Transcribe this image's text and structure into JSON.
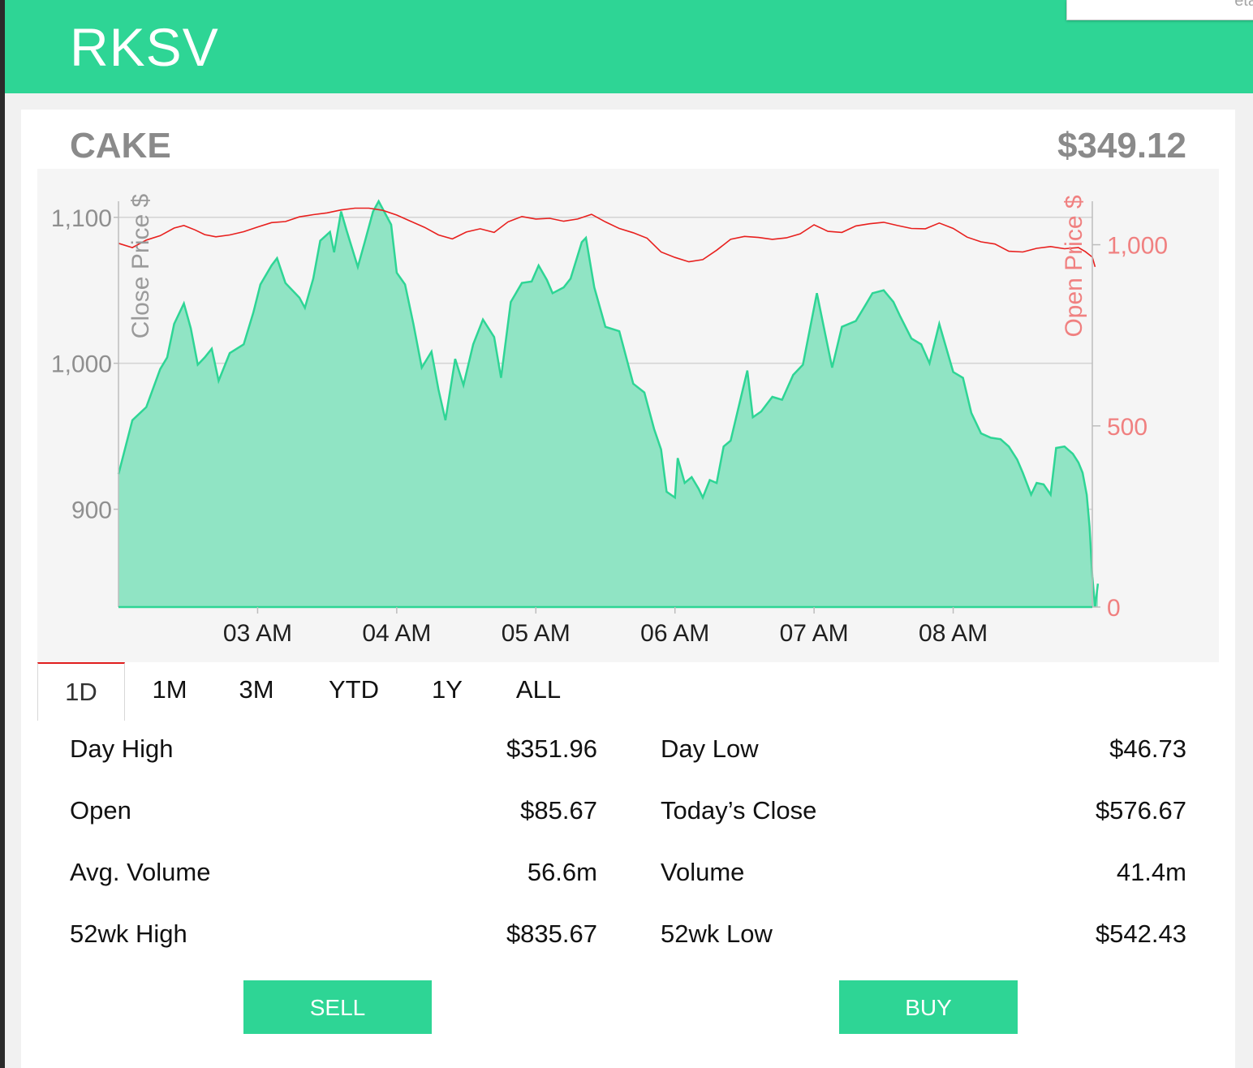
{
  "app": {
    "title": "RKSV"
  },
  "popup": {
    "partial_text": "eta"
  },
  "stock": {
    "symbol": "CAKE",
    "price": "$349.12"
  },
  "chart_data": {
    "type": "area",
    "title": "",
    "xlabel": "",
    "ylabel_left": "Close Price $",
    "ylabel_right": "Open Price $",
    "x_ticks": [
      "03 AM",
      "04 AM",
      "05 AM",
      "06 AM",
      "07 AM",
      "08 AM"
    ],
    "y_left_ticks": [
      900,
      1000,
      1100
    ],
    "y_left_tick_labels": [
      "900",
      "1,000",
      "1,100"
    ],
    "y_left_range": [
      833,
      1111
    ],
    "y_right_ticks": [
      0,
      500,
      1000
    ],
    "y_right_tick_labels": [
      "0",
      "500",
      "1,000"
    ],
    "y_right_range": [
      0,
      1120
    ],
    "x_range_hours": [
      2.0,
      9.0
    ],
    "grid": true,
    "colors": {
      "close": "#2ed595",
      "close_fill": "#90e4c4",
      "open": "#e8201e"
    },
    "series": [
      {
        "name": "Close Price $",
        "axis": "left",
        "points": [
          [
            2.0,
            924
          ],
          [
            2.1,
            961
          ],
          [
            2.2,
            970
          ],
          [
            2.3,
            996
          ],
          [
            2.35,
            1004
          ],
          [
            2.4,
            1027
          ],
          [
            2.47,
            1041
          ],
          [
            2.52,
            1024
          ],
          [
            2.57,
            999
          ],
          [
            2.62,
            1004
          ],
          [
            2.67,
            1010
          ],
          [
            2.72,
            988
          ],
          [
            2.8,
            1007
          ],
          [
            2.9,
            1013
          ],
          [
            2.97,
            1035
          ],
          [
            3.02,
            1054
          ],
          [
            3.1,
            1067
          ],
          [
            3.14,
            1072
          ],
          [
            3.2,
            1055
          ],
          [
            3.3,
            1045
          ],
          [
            3.34,
            1038
          ],
          [
            3.4,
            1058
          ],
          [
            3.45,
            1084
          ],
          [
            3.52,
            1090
          ],
          [
            3.55,
            1076
          ],
          [
            3.6,
            1104
          ],
          [
            3.64,
            1091
          ],
          [
            3.72,
            1066
          ],
          [
            3.77,
            1083
          ],
          [
            3.83,
            1104
          ],
          [
            3.87,
            1111
          ],
          [
            3.96,
            1095
          ],
          [
            4.0,
            1062
          ],
          [
            4.06,
            1054
          ],
          [
            4.12,
            1027
          ],
          [
            4.18,
            997
          ],
          [
            4.25,
            1008
          ],
          [
            4.3,
            982
          ],
          [
            4.35,
            961
          ],
          [
            4.42,
            1003
          ],
          [
            4.48,
            985
          ],
          [
            4.55,
            1013
          ],
          [
            4.62,
            1030
          ],
          [
            4.7,
            1018
          ],
          [
            4.75,
            990
          ],
          [
            4.82,
            1042
          ],
          [
            4.9,
            1055
          ],
          [
            4.97,
            1056
          ],
          [
            5.02,
            1067
          ],
          [
            5.08,
            1057
          ],
          [
            5.12,
            1048
          ],
          [
            5.2,
            1052
          ],
          [
            5.25,
            1058
          ],
          [
            5.33,
            1083
          ],
          [
            5.36,
            1086
          ],
          [
            5.42,
            1052
          ],
          [
            5.5,
            1025
          ],
          [
            5.6,
            1022
          ],
          [
            5.7,
            986
          ],
          [
            5.78,
            980
          ],
          [
            5.85,
            955
          ],
          [
            5.9,
            941
          ],
          [
            5.94,
            912
          ],
          [
            6.0,
            908
          ],
          [
            6.02,
            935
          ],
          [
            6.07,
            918
          ],
          [
            6.12,
            922
          ],
          [
            6.17,
            914
          ],
          [
            6.2,
            908
          ],
          [
            6.25,
            920
          ],
          [
            6.3,
            918
          ],
          [
            6.35,
            943
          ],
          [
            6.4,
            947
          ],
          [
            6.47,
            975
          ],
          [
            6.52,
            995
          ],
          [
            6.56,
            963
          ],
          [
            6.62,
            967
          ],
          [
            6.7,
            977
          ],
          [
            6.77,
            975
          ],
          [
            6.85,
            992
          ],
          [
            6.92,
            999
          ],
          [
            7.02,
            1048
          ],
          [
            7.08,
            1020
          ],
          [
            7.13,
            997
          ],
          [
            7.2,
            1025
          ],
          [
            7.3,
            1029
          ],
          [
            7.37,
            1040
          ],
          [
            7.42,
            1048
          ],
          [
            7.5,
            1050
          ],
          [
            7.57,
            1042
          ],
          [
            7.62,
            1032
          ],
          [
            7.7,
            1017
          ],
          [
            7.77,
            1013
          ],
          [
            7.83,
            1000
          ],
          [
            7.9,
            1027
          ],
          [
            8.0,
            994
          ],
          [
            8.07,
            990
          ],
          [
            8.13,
            966
          ],
          [
            8.2,
            952
          ],
          [
            8.27,
            949
          ],
          [
            8.34,
            948
          ],
          [
            8.4,
            943
          ],
          [
            8.46,
            934
          ],
          [
            8.5,
            925
          ],
          [
            8.56,
            910
          ],
          [
            8.6,
            918
          ],
          [
            8.65,
            917
          ],
          [
            8.7,
            910
          ],
          [
            8.74,
            942
          ],
          [
            8.8,
            943
          ],
          [
            8.86,
            938
          ],
          [
            8.9,
            932
          ],
          [
            8.93,
            925
          ],
          [
            8.96,
            910
          ],
          [
            8.98,
            888
          ],
          [
            9.0,
            854
          ],
          [
            9.02,
            833
          ],
          [
            9.04,
            849
          ]
        ]
      },
      {
        "name": "Open Price $",
        "axis": "right",
        "points": [
          [
            2.0,
            1004
          ],
          [
            2.1,
            992
          ],
          [
            2.2,
            1013
          ],
          [
            2.3,
            1025
          ],
          [
            2.4,
            1046
          ],
          [
            2.47,
            1053
          ],
          [
            2.55,
            1041
          ],
          [
            2.62,
            1028
          ],
          [
            2.7,
            1022
          ],
          [
            2.8,
            1027
          ],
          [
            2.9,
            1036
          ],
          [
            3.0,
            1049
          ],
          [
            3.1,
            1061
          ],
          [
            3.2,
            1064
          ],
          [
            3.3,
            1077
          ],
          [
            3.4,
            1083
          ],
          [
            3.5,
            1088
          ],
          [
            3.6,
            1096
          ],
          [
            3.7,
            1101
          ],
          [
            3.8,
            1101
          ],
          [
            3.9,
            1095
          ],
          [
            4.0,
            1082
          ],
          [
            4.1,
            1065
          ],
          [
            4.2,
            1048
          ],
          [
            4.3,
            1027
          ],
          [
            4.4,
            1016
          ],
          [
            4.5,
            1035
          ],
          [
            4.6,
            1044
          ],
          [
            4.7,
            1034
          ],
          [
            4.8,
            1063
          ],
          [
            4.9,
            1078
          ],
          [
            5.0,
            1071
          ],
          [
            5.1,
            1073
          ],
          [
            5.2,
            1065
          ],
          [
            5.3,
            1071
          ],
          [
            5.4,
            1084
          ],
          [
            5.5,
            1063
          ],
          [
            5.6,
            1045
          ],
          [
            5.7,
            1033
          ],
          [
            5.8,
            1018
          ],
          [
            5.9,
            980
          ],
          [
            6.0,
            965
          ],
          [
            6.1,
            953
          ],
          [
            6.2,
            959
          ],
          [
            6.3,
            985
          ],
          [
            6.4,
            1015
          ],
          [
            6.5,
            1023
          ],
          [
            6.6,
            1020
          ],
          [
            6.7,
            1015
          ],
          [
            6.8,
            1019
          ],
          [
            6.9,
            1030
          ],
          [
            7.0,
            1055
          ],
          [
            7.1,
            1037
          ],
          [
            7.2,
            1034
          ],
          [
            7.3,
            1052
          ],
          [
            7.4,
            1058
          ],
          [
            7.5,
            1062
          ],
          [
            7.6,
            1053
          ],
          [
            7.7,
            1045
          ],
          [
            7.8,
            1044
          ],
          [
            7.9,
            1060
          ],
          [
            8.0,
            1045
          ],
          [
            8.1,
            1021
          ],
          [
            8.2,
            1008
          ],
          [
            8.3,
            1002
          ],
          [
            8.4,
            982
          ],
          [
            8.5,
            980
          ],
          [
            8.6,
            990
          ],
          [
            8.7,
            995
          ],
          [
            8.8,
            989
          ],
          [
            8.9,
            992
          ],
          [
            8.95,
            981
          ],
          [
            9.0,
            966
          ],
          [
            9.02,
            939
          ]
        ]
      }
    ]
  },
  "tabs": [
    "1D",
    "1M",
    "3M",
    "YTD",
    "1Y",
    "ALL"
  ],
  "active_tab": "1D",
  "stats": {
    "left": [
      {
        "label": "Day High",
        "value": "$351.96"
      },
      {
        "label": "Open",
        "value": "$85.67"
      },
      {
        "label": "Avg. Volume",
        "value": "56.6m"
      },
      {
        "label": "52wk High",
        "value": "$835.67"
      }
    ],
    "right": [
      {
        "label": "Day Low",
        "value": "$46.73"
      },
      {
        "label": "Today’s Close",
        "value": "$576.67"
      },
      {
        "label": "Volume",
        "value": "41.4m"
      },
      {
        "label": "52wk Low",
        "value": "$542.43"
      }
    ]
  },
  "buttons": {
    "sell": "SELL",
    "buy": "BUY"
  }
}
